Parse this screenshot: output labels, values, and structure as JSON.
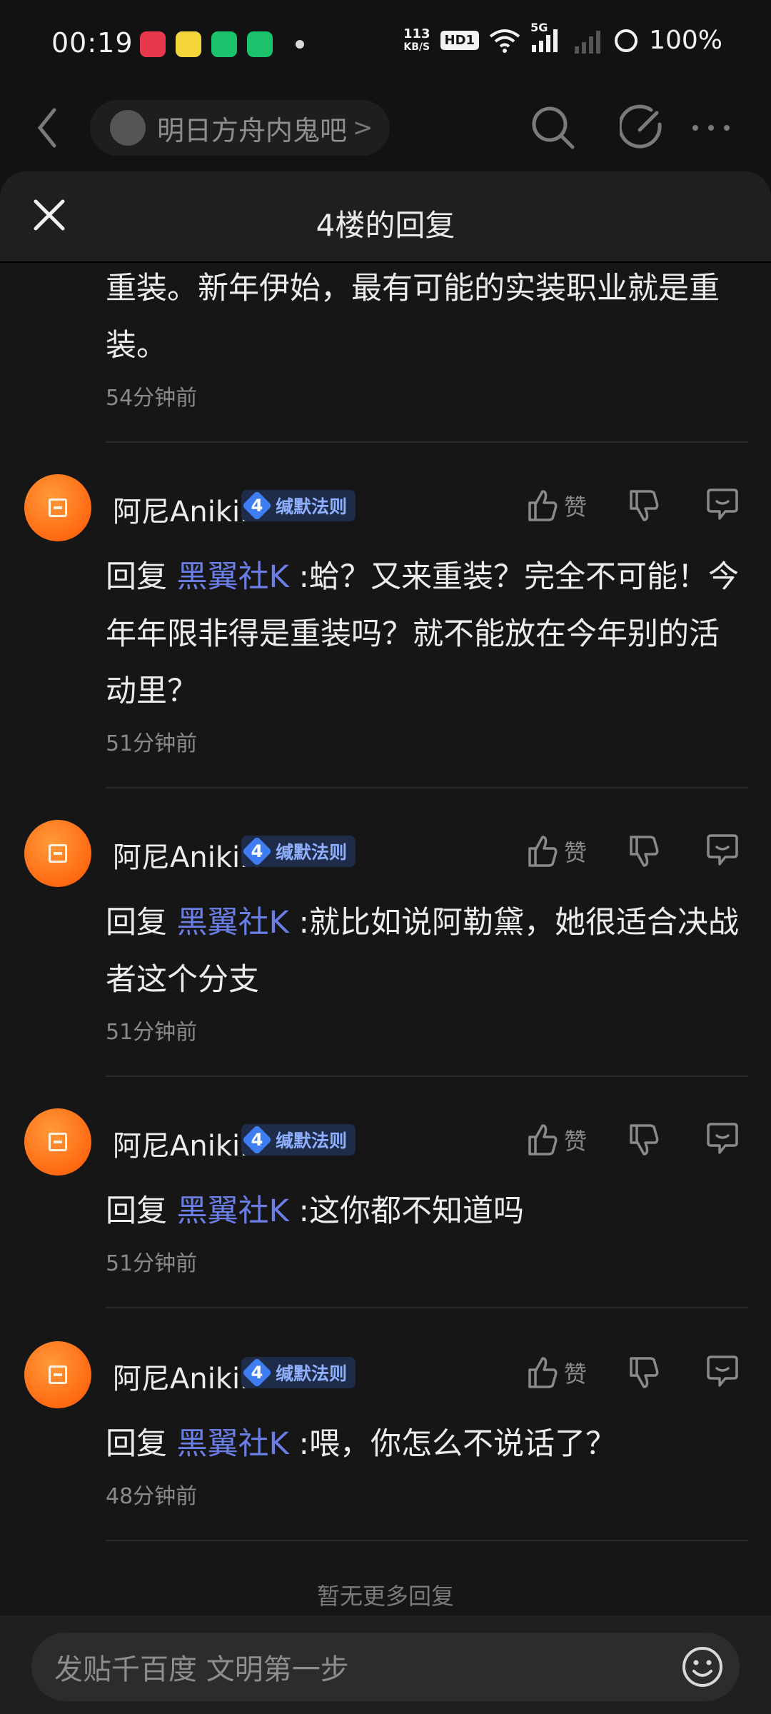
{
  "status": {
    "time": "00:19",
    "net_speed_top": "113",
    "net_speed_bottom": "KB/S",
    "hd": "HD1",
    "network": "5G",
    "battery": "100%"
  },
  "nav": {
    "forum_name": "明日方舟内鬼吧",
    "forum_chevron": ">"
  },
  "sheet": {
    "title": "4楼的回复",
    "top_partial": {
      "text": "重装。新年伊始，最有可能的实装职业就是重装。",
      "time": "54分钟前"
    },
    "replies": [
      {
        "user": "阿尼Anikii",
        "level": "4",
        "level_title": "缄默法则",
        "like_label": "赞",
        "prefix": "回复",
        "mention": "黑翼社K",
        "text": ":蛤？又来重装？完全不可能！今年年限非得是重装吗？就不能放在今年别的活动里？",
        "time": "51分钟前"
      },
      {
        "user": "阿尼Anikii",
        "level": "4",
        "level_title": "缄默法则",
        "like_label": "赞",
        "prefix": "回复",
        "mention": "黑翼社K",
        "text": ":就比如说阿勒黛，她很适合决战者这个分支",
        "time": "51分钟前"
      },
      {
        "user": "阿尼Anikii",
        "level": "4",
        "level_title": "缄默法则",
        "like_label": "赞",
        "prefix": "回复",
        "mention": "黑翼社K",
        "text": ":这你都不知道吗",
        "time": "51分钟前"
      },
      {
        "user": "阿尼Anikii",
        "level": "4",
        "level_title": "缄默法则",
        "like_label": "赞",
        "prefix": "回复",
        "mention": "黑翼社K",
        "text": ":喂，你怎么不说话了？",
        "time": "48分钟前"
      }
    ],
    "no_more": "暂无更多回复"
  },
  "input": {
    "placeholder": "发贴千百度 文明第一步"
  }
}
